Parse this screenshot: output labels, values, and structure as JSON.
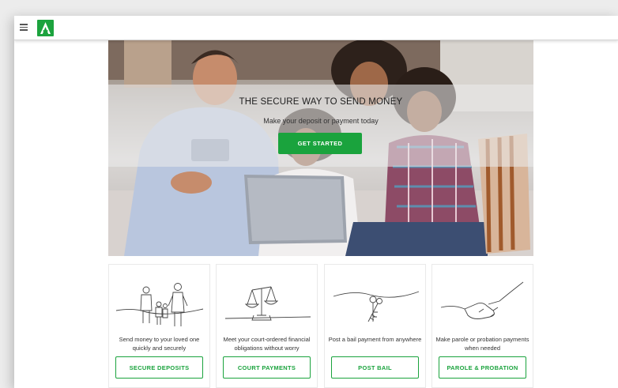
{
  "nav": {
    "menu_icon": "hamburger-menu-icon",
    "logo_icon": "a-logo-icon",
    "brand_color": "#1ca33e"
  },
  "hero": {
    "title": "THE SECURE WAY TO SEND MONEY",
    "subtitle": "Make your deposit or payment today",
    "cta_label": "GET STARTED"
  },
  "cards": [
    {
      "icon": "family-line-drawing-icon",
      "text": "Send money to your loved one quickly and securely",
      "button": "SECURE DEPOSITS"
    },
    {
      "icon": "scales-of-justice-icon",
      "text": "Meet your court-ordered financial obligations without worry",
      "button": "COURT PAYMENTS"
    },
    {
      "icon": "keys-icon",
      "text": "Post a bail payment from anywhere",
      "button": "POST BAIL"
    },
    {
      "icon": "handshake-icon",
      "text": "Make parole or probation payments when needed",
      "button": "PAROLE & PROBATION"
    }
  ],
  "colors": {
    "accent": "#1aa33d",
    "text": "#333333"
  }
}
